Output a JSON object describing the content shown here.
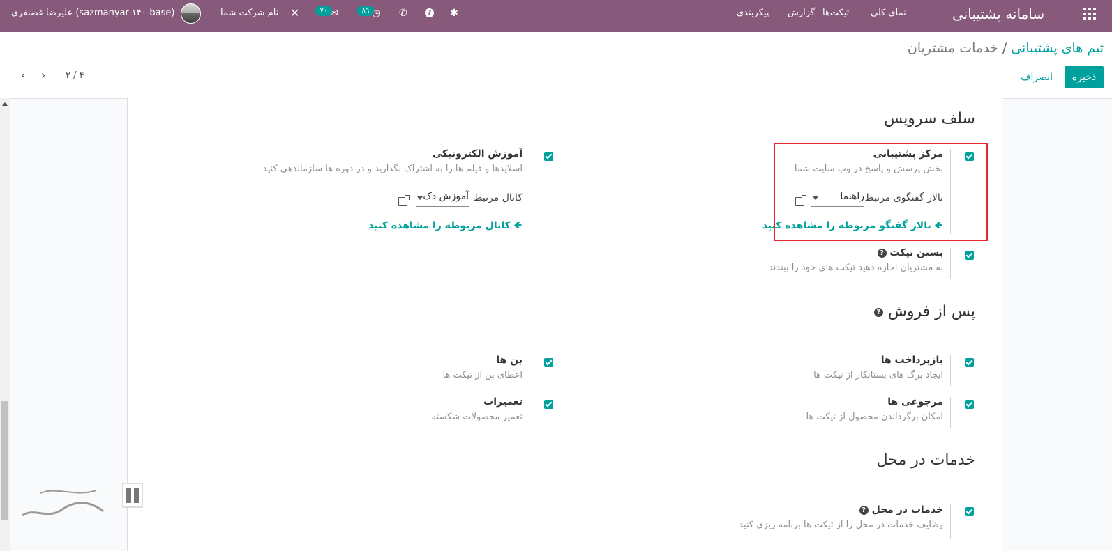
{
  "topbar": {
    "app_title": "سامانه پشتیبانی",
    "menu": [
      "نمای کلی",
      "تیکت‌ها",
      "گزارش",
      "پیکربندی"
    ],
    "chat_count": "۷۰",
    "activity_count": "۸۹",
    "company": "نام شرکت شما",
    "user": "علیرضا غضنفری (sazmanyar-۱۴۰-base)"
  },
  "breadcrumb": {
    "parent": "تیم های پشتیبانی",
    "separator": "/",
    "current": "خدمات مشتریان"
  },
  "actions": {
    "save": "ذخیره",
    "discard": "انصراف"
  },
  "pager": {
    "value": "۲ / ۴"
  },
  "sections": {
    "self_service": "سلف سرویس",
    "after_sales": "پس از فروش",
    "field_service": "خدمات در محل"
  },
  "help_center": {
    "title": "مرکز پشتیبانی",
    "desc": "بخش پرسش و پاسخ در وب سایت شما",
    "forum_label": "تالار گفتگوی مرتبط",
    "forum_value": "راهنما",
    "link": "تالار گفتگو مربوطه را مشاهده کنید"
  },
  "elearning": {
    "title": "آموزش الکترونیکی",
    "desc": "اسلایدها و فیلم ها را به اشتراک بگذارید و در دوره ها سازماندهی کنید",
    "channel_label": "کانال مرتبط",
    "channel_value": "آموزش دک",
    "link": "کانال مربوطه را مشاهده کنید"
  },
  "close_ticket": {
    "title": "بستن تیکت",
    "desc": "به مشتریان اجازه دهید تیکت های خود را ببندند"
  },
  "refunds": {
    "title": "بازپرداخت ها",
    "desc": "ایجاد برگ های بستانکار از تیکت ها"
  },
  "coupons": {
    "title": "بن ها",
    "desc": "اعطای بن از تیکت ها"
  },
  "returns": {
    "title": "مرجوعی ها",
    "desc": "امکان برگرداندن محصول از تیکت ها"
  },
  "repairs": {
    "title": "تعمیرات",
    "desc": "تعمیر محصولات شکسته"
  },
  "onsite": {
    "title": "خدمات در محل",
    "desc": "وظایف خدمات در محل را از تیکت ها برنامه ریزی کنید"
  },
  "colors": {
    "topbar": "#875a7b",
    "accent": "#00a09d",
    "highlight": "#e0282e"
  }
}
